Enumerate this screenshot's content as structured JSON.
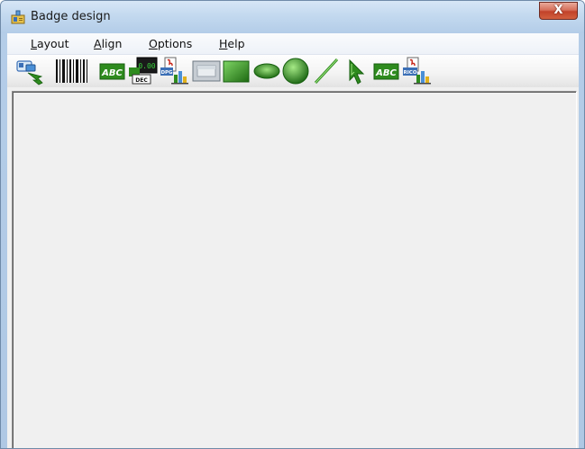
{
  "window": {
    "title": "Badge design",
    "close_glyph": "X"
  },
  "menu": {
    "items": [
      {
        "accel": "L",
        "rest": "ayout"
      },
      {
        "accel": "A",
        "rest": "lign"
      },
      {
        "accel": "O",
        "rest": "ptions"
      },
      {
        "accel": "H",
        "rest": "elp"
      }
    ]
  },
  "toolbar": {
    "tools": [
      {
        "icon": "export-arrow-icon"
      },
      {
        "icon": "barcode-icon"
      },
      {
        "icon": "abc-text-icon",
        "label": "ABC"
      },
      {
        "icon": "counter-dec-icon",
        "label": "DEC",
        "digits": "0.00"
      },
      {
        "icon": "image-dpg-icon",
        "label": "DPG"
      },
      {
        "icon": "frame-icon"
      },
      {
        "icon": "rectangle-icon"
      },
      {
        "icon": "ellipse-icon"
      },
      {
        "icon": "circle-icon"
      },
      {
        "icon": "line-icon"
      },
      {
        "icon": "pointer-icon"
      },
      {
        "icon": "abc-text-icon-2",
        "label": "ABC"
      },
      {
        "icon": "image-rico-icon",
        "label": "RICO"
      }
    ]
  },
  "colors": {
    "accent_green": "#2e8b1e",
    "title_close_red": "#c2422a",
    "canvas_bg": "#f0f0f0"
  }
}
